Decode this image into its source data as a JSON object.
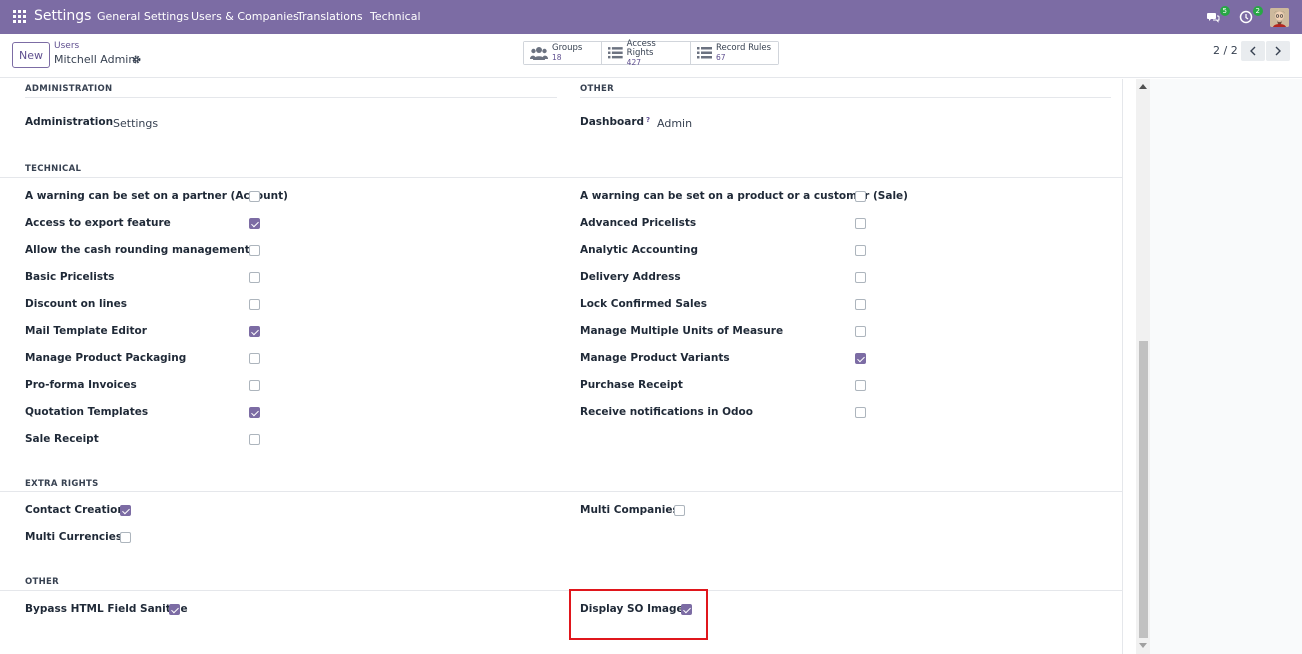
{
  "topbar": {
    "app_title": "Settings",
    "menu": [
      "General Settings",
      "Users & Companies",
      "Translations",
      "Technical"
    ],
    "messages_count": "5",
    "activities_count": "2"
  },
  "control": {
    "new_label": "New",
    "breadcrumb_parent": "Users",
    "breadcrumb_current": "Mitchell Admin",
    "pager": "2 / 2"
  },
  "smart_buttons": [
    {
      "label": "Groups",
      "value": "18"
    },
    {
      "label": "Access Rights",
      "value": "427"
    },
    {
      "label": "Record Rules",
      "value": "67"
    }
  ],
  "sections": {
    "administration": {
      "title": "ADMINISTRATION",
      "label": "Administration",
      "value": "Settings"
    },
    "other_top": {
      "title": "OTHER",
      "label": "Dashboard",
      "help": "?",
      "value": "Admin"
    },
    "technical": {
      "title": "TECHNICAL",
      "left": [
        {
          "label": "A warning can be set on a partner (Account)",
          "checked": false
        },
        {
          "label": "Access to export feature",
          "checked": true
        },
        {
          "label": "Allow the cash rounding management",
          "checked": false
        },
        {
          "label": "Basic Pricelists",
          "checked": false
        },
        {
          "label": "Discount on lines",
          "checked": false
        },
        {
          "label": "Mail Template Editor",
          "checked": true
        },
        {
          "label": "Manage Product Packaging",
          "checked": false
        },
        {
          "label": "Pro-forma Invoices",
          "checked": false
        },
        {
          "label": "Quotation Templates",
          "checked": true
        },
        {
          "label": "Sale Receipt",
          "checked": false
        }
      ],
      "right": [
        {
          "label": "A warning can be set on a product or a customer (Sale)",
          "checked": false
        },
        {
          "label": "Advanced Pricelists",
          "checked": false
        },
        {
          "label": "Analytic Accounting",
          "checked": false
        },
        {
          "label": "Delivery Address",
          "checked": false
        },
        {
          "label": "Lock Confirmed Sales",
          "checked": false
        },
        {
          "label": "Manage Multiple Units of Measure",
          "checked": false
        },
        {
          "label": "Manage Product Variants",
          "checked": true
        },
        {
          "label": "Purchase Receipt",
          "checked": false
        },
        {
          "label": "Receive notifications in Odoo",
          "checked": false
        }
      ]
    },
    "extra_rights": {
      "title": "EXTRA RIGHTS",
      "left": [
        {
          "label": "Contact Creation",
          "checked": true
        },
        {
          "label": "Multi Currencies",
          "checked": false
        }
      ],
      "right": [
        {
          "label": "Multi Companies",
          "checked": false
        }
      ]
    },
    "other_bottom": {
      "title": "OTHER",
      "left": [
        {
          "label": "Bypass HTML Field Sanitize",
          "checked": true
        }
      ],
      "right": [
        {
          "label": "Display SO Images",
          "checked": true
        }
      ]
    }
  },
  "colors": {
    "brand": "#7c6ca4",
    "highlight": "#e0161c"
  }
}
